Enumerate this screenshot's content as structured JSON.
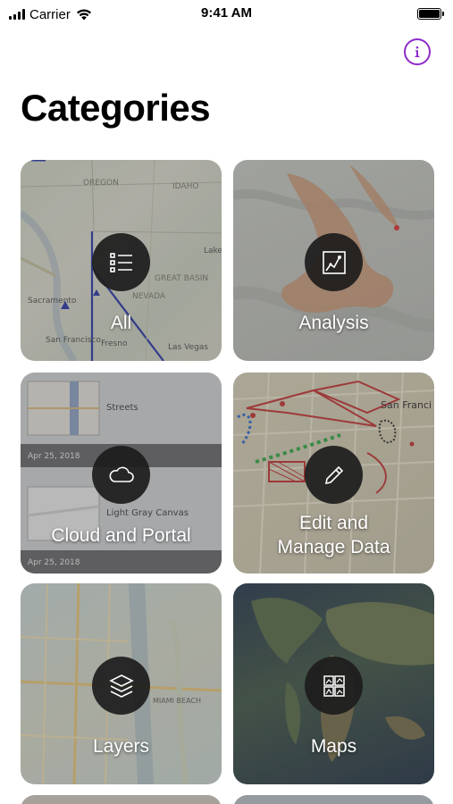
{
  "status_bar": {
    "carrier": "Carrier",
    "time": "9:41 AM",
    "icons": [
      "signal-icon",
      "wifi-icon",
      "battery-icon"
    ]
  },
  "header": {
    "title": "Categories",
    "info_icon": "info-icon",
    "accent_color": "#8e2bc8"
  },
  "categories": [
    {
      "label": "All",
      "icon": "list-icon"
    },
    {
      "label": "Analysis",
      "icon": "analysis-icon"
    },
    {
      "label": "Cloud and Portal",
      "icon": "cloud-icon",
      "preview": {
        "items": [
          {
            "title": "Streets",
            "date": "Apr 25, 2018"
          },
          {
            "title": "Light Gray Canvas",
            "date": "Apr 25, 2018"
          }
        ]
      }
    },
    {
      "label_lines": [
        "Edit and",
        "Manage Data"
      ],
      "icon": "pencil-icon"
    },
    {
      "label": "Layers",
      "icon": "layers-icon",
      "map_text": [
        "MIAMI BEACH"
      ]
    },
    {
      "label": "Maps",
      "icon": "maps-icon"
    }
  ],
  "map_text": {
    "all": [
      "OREGON",
      "IDAHO",
      "GREAT BASIN",
      "NEVADA",
      "Sacramento",
      "San Francisco",
      "Fresno",
      "Las Vegas",
      "Lake"
    ],
    "edit": [
      "San Franci"
    ]
  }
}
